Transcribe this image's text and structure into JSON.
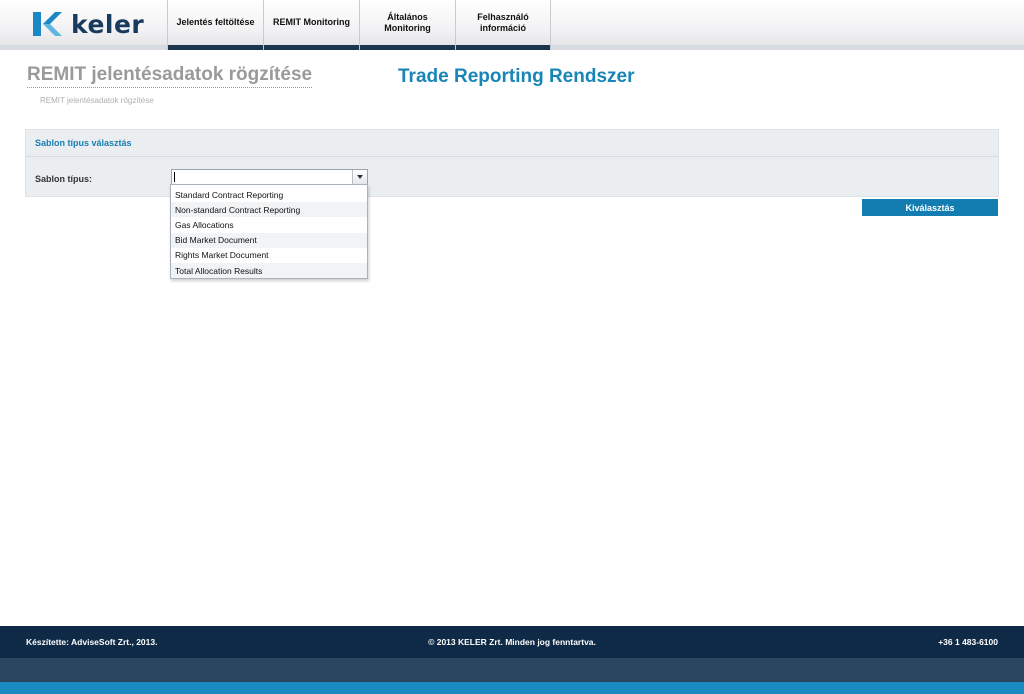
{
  "brand": {
    "name": "keler",
    "color": "#1a88c4"
  },
  "nav": {
    "items": [
      {
        "label": "Jelentés feltöltése"
      },
      {
        "label": "REMIT Monitoring"
      },
      {
        "label": "Általános\nMonitoring"
      },
      {
        "label": "Felhasználó\ninformáció"
      }
    ]
  },
  "page": {
    "title": "REMIT jelentésadatok rögzítése",
    "app_title": "Trade Reporting Rendszer",
    "breadcrumb": "REMIT jelentésadatok rögzítése"
  },
  "panel": {
    "title": "Sablon típus választás",
    "field_label": "Sablon típus:",
    "select_value": ""
  },
  "dropdown": {
    "options": [
      "Standard Contract Reporting",
      "Non-standard Contract Reporting",
      "Gas Allocations",
      "Bid Market Document",
      "Rights Market Document",
      "Total Allocation Results"
    ]
  },
  "actions": {
    "select_button": "Kiválasztás"
  },
  "footer": {
    "left": "Készítette: AdviseSoft Zrt., 2013.",
    "center": "© 2013 KELER Zrt. Minden jog fenntartva.",
    "right": "+36 1 483-6100"
  },
  "colors": {
    "accent": "#1985b7",
    "button": "#137cb1",
    "footer": "#0f2a46",
    "nav_bar": "#1c3650"
  }
}
